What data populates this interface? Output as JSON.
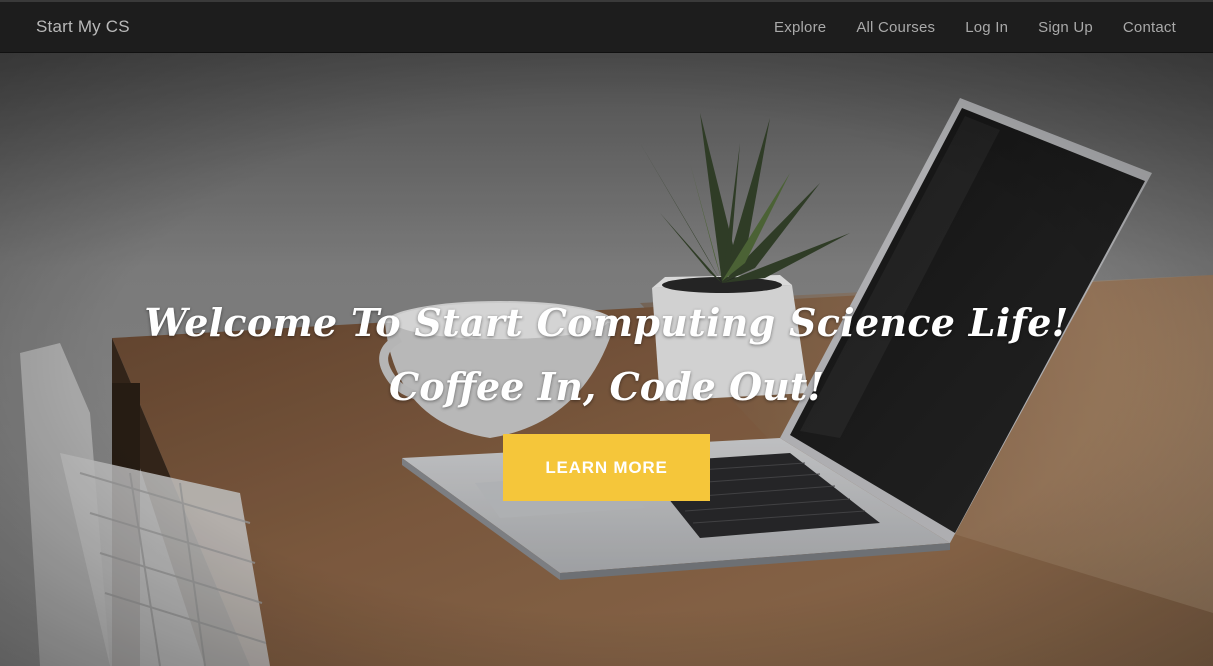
{
  "navbar": {
    "brand": "Start My CS",
    "links": [
      "Explore",
      "All Courses",
      "Log In",
      "Sign Up",
      "Contact"
    ]
  },
  "hero": {
    "title": "Welcome To Start Computing Science Life!",
    "subtitle": "Coffee In, Code Out!",
    "cta_label": "LEARN MORE"
  },
  "colors": {
    "navbar_bg": "#1d1d1d",
    "cta_bg": "#f5c63a",
    "nav_text": "#a9a9a9"
  }
}
